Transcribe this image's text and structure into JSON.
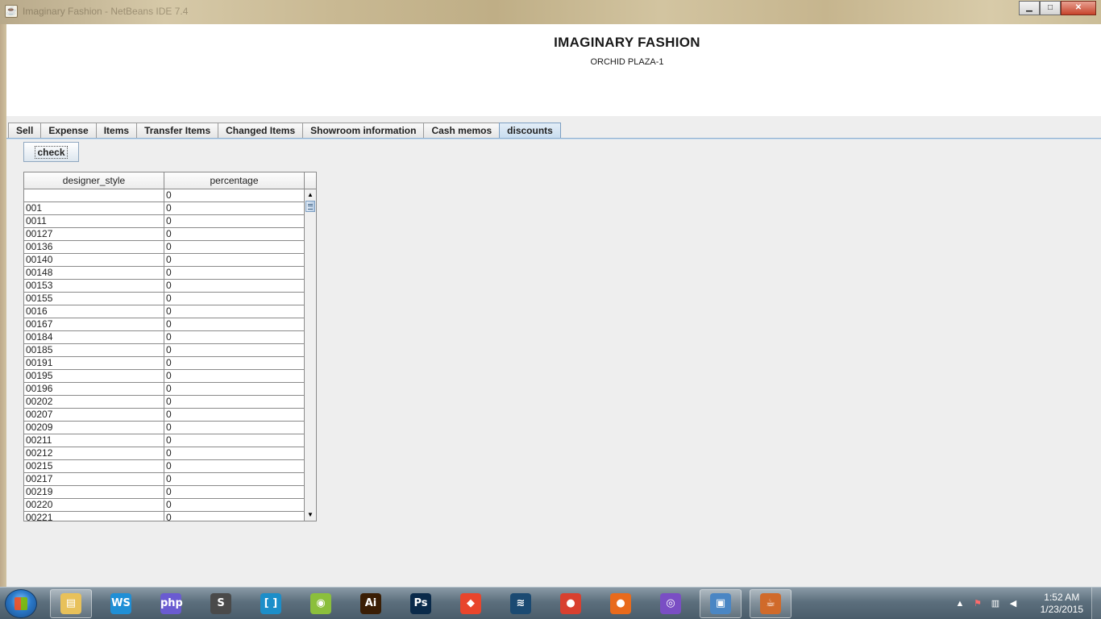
{
  "window": {
    "title": "Imaginary Fashion - NetBeans IDE 7.4",
    "min_icon": "minimize-icon",
    "max_icon": "maximize-icon",
    "close_icon": "close-icon",
    "min_glyph": "▁",
    "max_glyph": "□",
    "close_glyph": "✕"
  },
  "header": {
    "company": "IMAGINARY FASHION",
    "address": "ORCHID PLAZA-1"
  },
  "tabs": [
    {
      "label": "Sell",
      "active": false
    },
    {
      "label": "Expense",
      "active": false
    },
    {
      "label": "Items",
      "active": false
    },
    {
      "label": "Transfer Items",
      "active": false
    },
    {
      "label": "Changed Items",
      "active": false
    },
    {
      "label": "Showroom information",
      "active": false
    },
    {
      "label": "Cash memos",
      "active": false
    },
    {
      "label": "discounts",
      "active": true
    }
  ],
  "discounts": {
    "check_label": "check",
    "columns": [
      "designer_style",
      "percentage"
    ],
    "rows": [
      [
        "",
        "0"
      ],
      [
        "001",
        "0"
      ],
      [
        "0011",
        "0"
      ],
      [
        "00127",
        "0"
      ],
      [
        "00136",
        "0"
      ],
      [
        "00140",
        "0"
      ],
      [
        "00148",
        "0"
      ],
      [
        "00153",
        "0"
      ],
      [
        "00155",
        "0"
      ],
      [
        "0016",
        "0"
      ],
      [
        "00167",
        "0"
      ],
      [
        "00184",
        "0"
      ],
      [
        "00185",
        "0"
      ],
      [
        "00191",
        "0"
      ],
      [
        "00195",
        "0"
      ],
      [
        "00196",
        "0"
      ],
      [
        "00202",
        "0"
      ],
      [
        "00207",
        "0"
      ],
      [
        "00209",
        "0"
      ],
      [
        "00211",
        "0"
      ],
      [
        "00212",
        "0"
      ],
      [
        "00215",
        "0"
      ],
      [
        "00217",
        "0"
      ],
      [
        "00219",
        "0"
      ],
      [
        "00220",
        "0"
      ],
      [
        "00221",
        "0"
      ]
    ],
    "scroll_up": "▲",
    "scroll_down": "▼"
  },
  "taskbar": {
    "apps": [
      {
        "name": "windows-explorer-icon",
        "glyph": "▤",
        "color": "#e8c15a",
        "open": true
      },
      {
        "name": "webstorm-icon",
        "glyph": "WS",
        "color": "#1f8fd6",
        "open": false
      },
      {
        "name": "phpstorm-icon",
        "glyph": "php",
        "color": "#6a5bd1",
        "open": false
      },
      {
        "name": "sublime-text-icon",
        "glyph": "S",
        "color": "#4a4a4a",
        "open": false
      },
      {
        "name": "brackets-icon",
        "glyph": "[ ]",
        "color": "#1c8ec9",
        "open": false
      },
      {
        "name": "android-icon",
        "glyph": "◉",
        "color": "#8bbf3c",
        "open": false
      },
      {
        "name": "illustrator-icon",
        "glyph": "Ai",
        "color": "#3a1e05",
        "open": false
      },
      {
        "name": "photoshop-icon",
        "glyph": "Ps",
        "color": "#0a2a4a",
        "open": false
      },
      {
        "name": "git-icon",
        "glyph": "◆",
        "color": "#e8452c",
        "open": false
      },
      {
        "name": "mysql-workbench-icon",
        "glyph": "≋",
        "color": "#1b4a72",
        "open": false
      },
      {
        "name": "chrome-icon",
        "glyph": "●",
        "color": "#d8402f",
        "open": false
      },
      {
        "name": "firefox-icon",
        "glyph": "●",
        "color": "#e86a1c",
        "open": false
      },
      {
        "name": "bittorrent-icon",
        "glyph": "◎",
        "color": "#7a4ec4",
        "open": false
      },
      {
        "name": "virtualbox-icon",
        "glyph": "▣",
        "color": "#4a86c4",
        "open": true
      },
      {
        "name": "java-icon",
        "glyph": "☕",
        "color": "#d06a2a",
        "open": true
      }
    ],
    "tray": {
      "chevron": "▲",
      "time": "1:52 AM",
      "date": "1/23/2015"
    }
  }
}
